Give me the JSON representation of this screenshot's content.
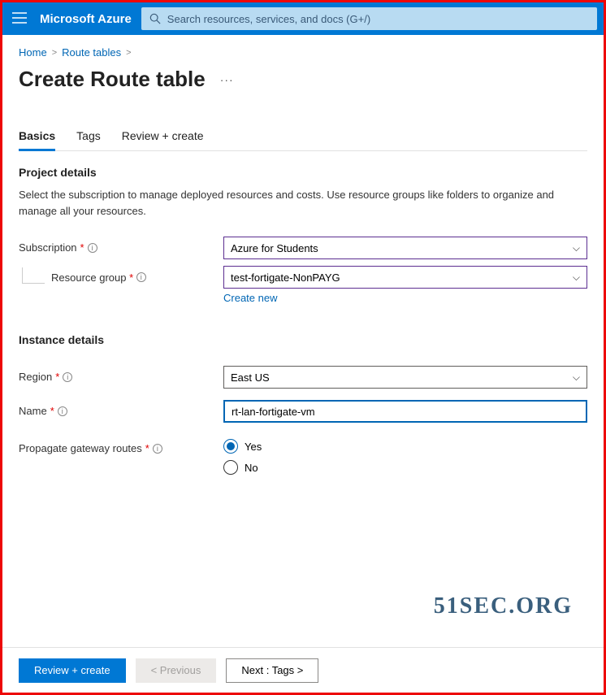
{
  "topbar": {
    "brand": "Microsoft Azure",
    "search_placeholder": "Search resources, services, and docs (G+/)"
  },
  "breadcrumb": {
    "home": "Home",
    "route_tables": "Route tables"
  },
  "page_title": "Create Route table",
  "tabs": {
    "basics": "Basics",
    "tags": "Tags",
    "review": "Review + create"
  },
  "project_details": {
    "heading": "Project details",
    "description": "Select the subscription to manage deployed resources and costs. Use resource groups like folders to organize and manage all your resources.",
    "subscription_label": "Subscription",
    "subscription_value": "Azure for Students",
    "resource_group_label": "Resource group",
    "resource_group_value": "test-fortigate-NonPAYG",
    "create_new": "Create new"
  },
  "instance_details": {
    "heading": "Instance details",
    "region_label": "Region",
    "region_value": "East US",
    "name_label": "Name",
    "name_value": "rt-lan-fortigate-vm",
    "propagate_label": "Propagate gateway routes",
    "yes": "Yes",
    "no": "No"
  },
  "watermark": "51SEC.ORG",
  "footer": {
    "review": "Review + create",
    "previous": "< Previous",
    "next": "Next : Tags >"
  }
}
